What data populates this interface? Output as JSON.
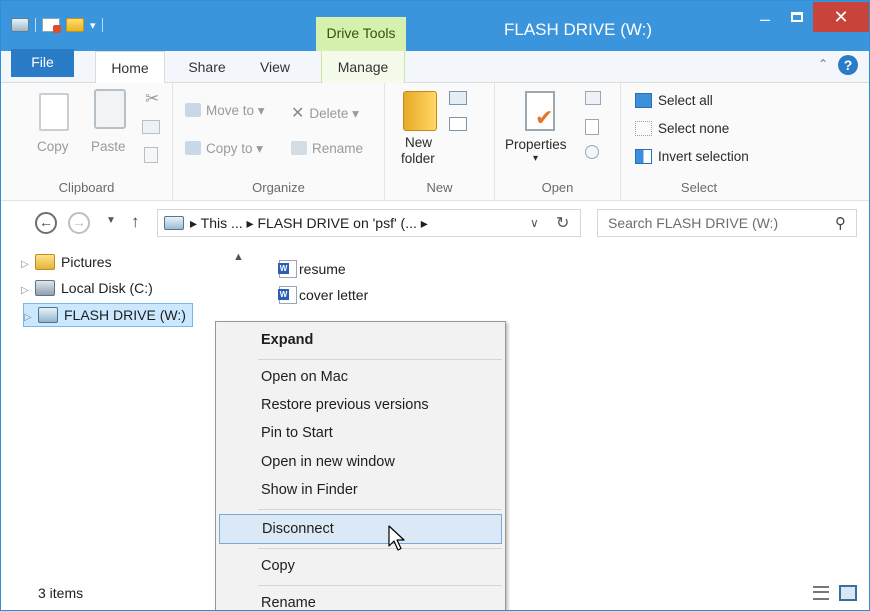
{
  "window": {
    "title": "FLASH DRIVE (W:)",
    "context_tab_group": "Drive Tools",
    "controls": {
      "minimize": "‒",
      "close": "✕"
    }
  },
  "ribbon": {
    "tabs": [
      {
        "label": "File"
      },
      {
        "label": "Home"
      },
      {
        "label": "Share"
      },
      {
        "label": "View"
      },
      {
        "label": "Manage"
      }
    ],
    "groups": {
      "clipboard": {
        "label": "Clipboard",
        "copy": "Copy",
        "paste": "Paste"
      },
      "organize": {
        "label": "Organize",
        "move_to": "Move to ▾",
        "delete": "Delete ▾",
        "copy_to": "Copy to ▾",
        "rename": "Rename"
      },
      "new": {
        "label": "New",
        "new_folder_line1": "New",
        "new_folder_line2": "folder"
      },
      "open": {
        "label": "Open",
        "properties": "Properties",
        "properties_arrow": "▾"
      },
      "select": {
        "label": "Select",
        "select_all": "Select all",
        "select_none": "Select none",
        "invert_selection": "Invert selection"
      }
    }
  },
  "address_bar": {
    "path": "▸ This ...  ▸  FLASH DRIVE on 'psf' (...  ▸",
    "search_placeholder": "Search FLASH DRIVE (W:)"
  },
  "nav_pane": {
    "items": [
      {
        "label": "Pictures",
        "icon": "pictures-folder-icon"
      },
      {
        "label": "Local Disk (C:)",
        "icon": "local-disk-icon"
      },
      {
        "label": "FLASH DRIVE (W:)",
        "icon": "network-drive-icon",
        "selected": true
      }
    ]
  },
  "files": [
    {
      "name": "resume",
      "icon": "word-document-icon"
    },
    {
      "name": "cover letter",
      "icon": "word-document-icon"
    }
  ],
  "context_menu": {
    "items": [
      {
        "label": "Expand",
        "bold": true
      },
      {
        "label": "Open on Mac"
      },
      {
        "label": "Restore previous versions"
      },
      {
        "label": "Pin to Start"
      },
      {
        "label": "Open in new window"
      },
      {
        "label": "Show in Finder"
      },
      {
        "label": "Disconnect",
        "highlighted": true
      },
      {
        "label": "Copy"
      },
      {
        "label": "Rename"
      }
    ]
  },
  "status_bar": {
    "item_count": "3 items"
  },
  "colors": {
    "titlebar": "#3a95dc",
    "file_tab": "#2a7cc7",
    "close_button": "#c8443a",
    "drive_tools": "#d6f0ad",
    "selection": "#cce8ff",
    "menu_highlight": "#dbe9f7"
  }
}
